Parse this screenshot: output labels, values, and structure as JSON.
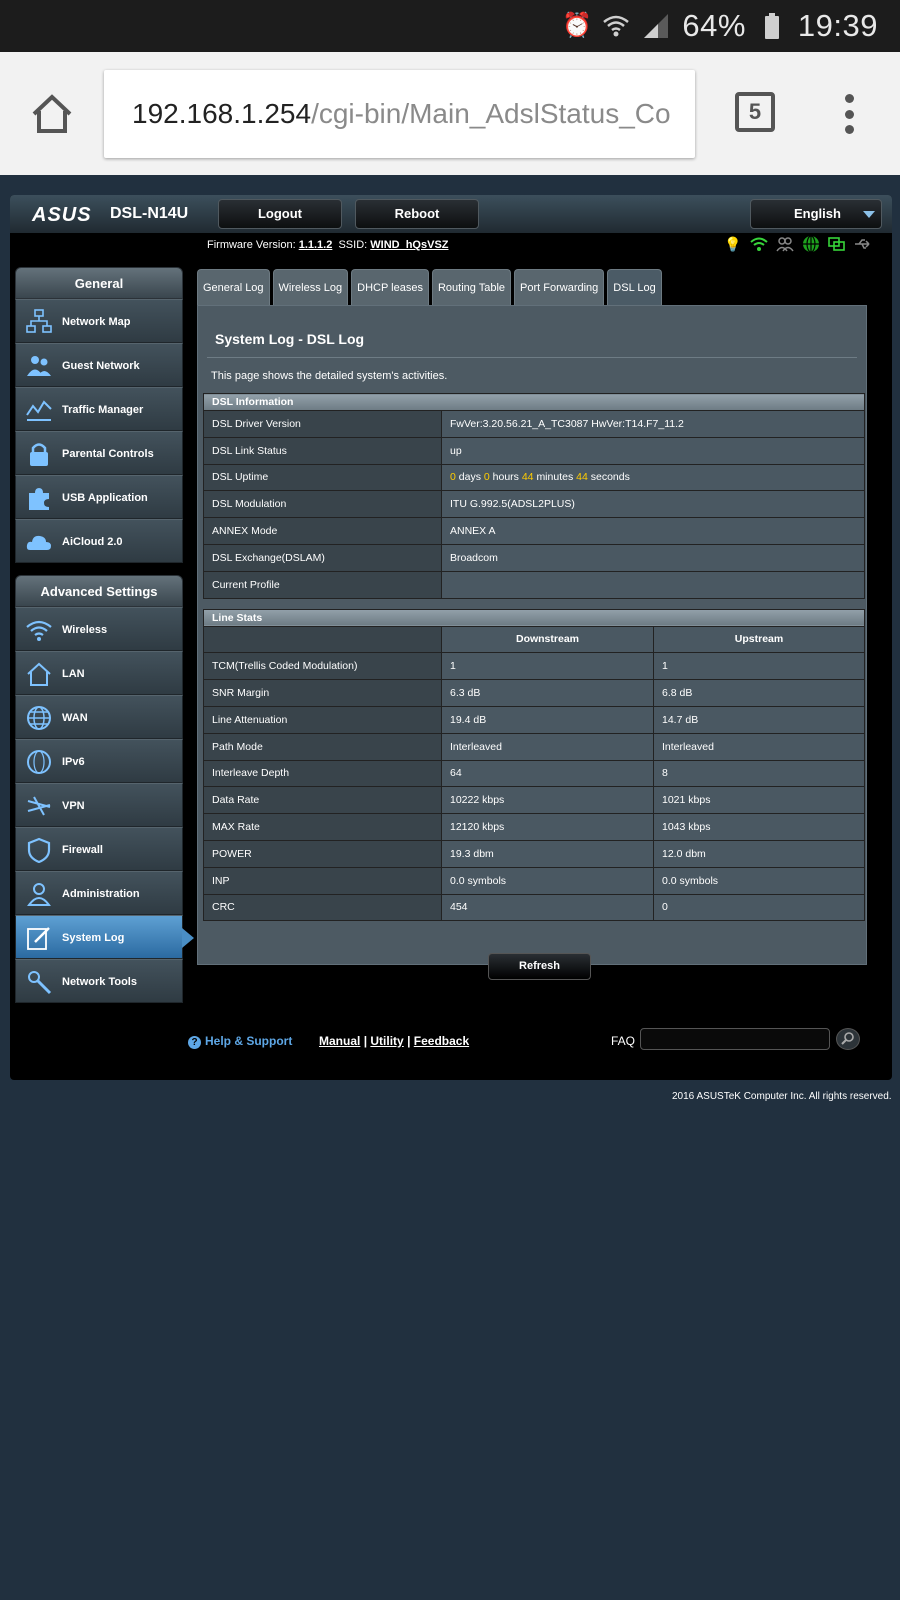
{
  "status_bar": {
    "battery": "64%",
    "time": "19:39",
    "icons": [
      "alarm-icon",
      "wifi-icon",
      "signal-icon",
      "battery-icon"
    ]
  },
  "browser": {
    "url_host": "192.168.1.254",
    "url_path": "/cgi-bin/Main_AdslStatus_Co",
    "tab_count": "5"
  },
  "router": {
    "brand": "ASUS",
    "model": "DSL-N14U",
    "logout": "Logout",
    "reboot": "Reboot",
    "language": "English",
    "firmware_label": "Firmware Version:",
    "firmware": "1.1.1.2",
    "ssid_label": "SSID:",
    "ssid": "WIND_hQsVSZ"
  },
  "sidebar": {
    "general_heading": "General",
    "general_items": [
      "Network Map",
      "Guest Network",
      "Traffic Manager",
      "Parental Controls",
      "USB Application",
      "AiCloud 2.0"
    ],
    "advanced_heading": "Advanced Settings",
    "advanced_items": [
      "Wireless",
      "LAN",
      "WAN",
      "IPv6",
      "VPN",
      "Firewall",
      "Administration",
      "System Log",
      "Network Tools"
    ]
  },
  "tabs": [
    "General Log",
    "Wireless Log",
    "DHCP leases",
    "Routing Table",
    "Port Forwarding",
    "DSL Log"
  ],
  "page": {
    "title": "System Log - DSL Log",
    "description": "This page shows the detailed system's activities."
  },
  "dsl_info": {
    "heading": "DSL Information",
    "rows": [
      {
        "label": "DSL Driver Version",
        "value": "FwVer:3.20.56.21_A_TC3087 HwVer:T14.F7_11.2"
      },
      {
        "label": "DSL Link Status",
        "value": "up"
      },
      {
        "label": "DSL Uptime",
        "days": "0",
        "days_unit": "days",
        "hours": "0",
        "hours_unit": "hours",
        "minutes": "44",
        "minutes_unit": "minutes",
        "seconds": "44",
        "seconds_unit": "seconds"
      },
      {
        "label": "DSL Modulation",
        "value": "ITU G.992.5(ADSL2PLUS)"
      },
      {
        "label": "ANNEX Mode",
        "value": "ANNEX A"
      },
      {
        "label": "DSL Exchange(DSLAM)",
        "value": "Broadcom"
      },
      {
        "label": "Current Profile",
        "value": ""
      }
    ]
  },
  "line_stats": {
    "heading": "Line Stats",
    "columns": [
      "Downstream",
      "Upstream"
    ],
    "rows": [
      {
        "label": "TCM(Trellis Coded Modulation)",
        "down": "1",
        "up": "1"
      },
      {
        "label": "SNR Margin",
        "down": "6.3 dB",
        "up": "6.8 dB"
      },
      {
        "label": "Line Attenuation",
        "down": "19.4 dB",
        "up": "14.7 dB"
      },
      {
        "label": "Path Mode",
        "down": "Interleaved",
        "up": "Interleaved"
      },
      {
        "label": "Interleave Depth",
        "down": "64",
        "up": "8"
      },
      {
        "label": "Data Rate",
        "down": "10222 kbps",
        "up": "1021 kbps"
      },
      {
        "label": "MAX Rate",
        "down": "12120 kbps",
        "up": "1043 kbps"
      },
      {
        "label": "POWER",
        "down": "19.3 dbm",
        "up": "12.0 dbm"
      },
      {
        "label": "INP",
        "down": "0.0 symbols",
        "up": "0.0 symbols"
      },
      {
        "label": "CRC",
        "down": "454",
        "up": "0"
      }
    ]
  },
  "refresh": "Refresh",
  "footer": {
    "help": "Help & Support",
    "manual": "Manual",
    "utility": "Utility",
    "feedback": "Feedback",
    "separator": "|",
    "faq": "FAQ",
    "copyright": "2016 ASUSTeK Computer Inc. All rights reserved."
  }
}
